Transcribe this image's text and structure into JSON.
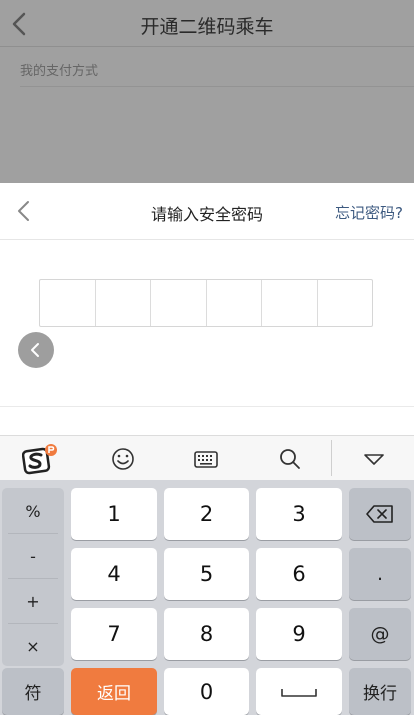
{
  "background_page": {
    "title": "开通二维码乘车",
    "subtitle": "我的支付方式"
  },
  "sheet": {
    "title": "请输入安全密码",
    "forgot_link": "忘记密码?",
    "pin_length": 6
  },
  "keyboard": {
    "toolbar": [
      "sogou-logo",
      "emoji",
      "keyboard",
      "search",
      "collapse"
    ],
    "side_keys": [
      "%",
      "-",
      "+",
      "×"
    ],
    "symbol_key": "符",
    "digit_rows": [
      [
        "1",
        "2",
        "3"
      ],
      [
        "4",
        "5",
        "6"
      ],
      [
        "7",
        "8",
        "9"
      ]
    ],
    "zero": "0",
    "back_key": "返回",
    "dot_key": ".",
    "at_key": "@",
    "enter_key": "换行"
  },
  "colors": {
    "overlay": "#a0a0a0",
    "accent_orange": "#f07b3f",
    "link_blue": "#3d5a80",
    "keyboard_bg": "#d3d5da"
  }
}
